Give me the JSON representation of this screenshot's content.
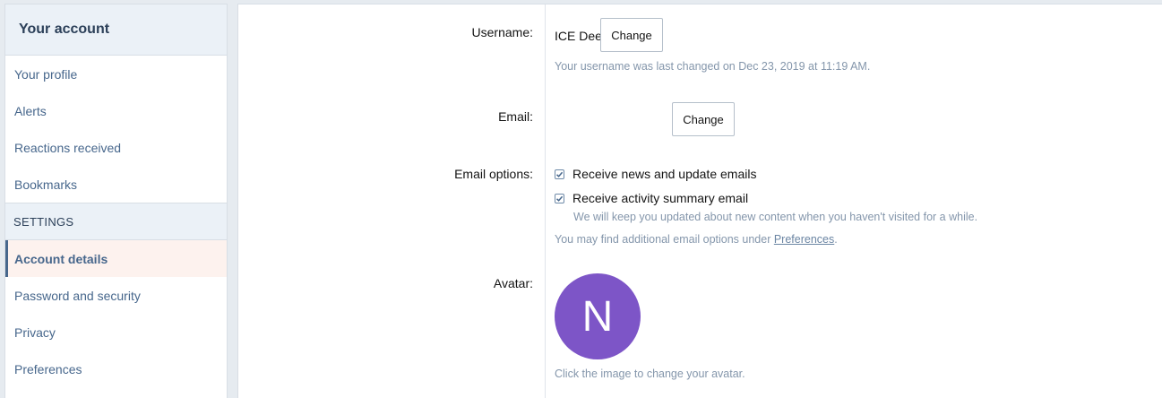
{
  "sidebar": {
    "title": "Your account",
    "items_top": [
      {
        "label": "Your profile"
      },
      {
        "label": "Alerts"
      },
      {
        "label": "Reactions received"
      },
      {
        "label": "Bookmarks"
      }
    ],
    "settings_header": "SETTINGS",
    "items_settings": [
      {
        "label": "Account details",
        "active": true
      },
      {
        "label": "Password and security"
      },
      {
        "label": "Privacy"
      },
      {
        "label": "Preferences"
      }
    ]
  },
  "form": {
    "username": {
      "label": "Username:",
      "value": "ICE Dee",
      "change_label": "Change",
      "hint": "Your username was last changed on Dec 23, 2019 at 11:19 AM."
    },
    "email": {
      "label": "Email:",
      "change_label": "Change"
    },
    "email_options": {
      "label": "Email options:",
      "option1": "Receive news and update emails",
      "option1_checked": true,
      "option2": "Receive activity summary email",
      "option2_checked": true,
      "option2_hint": "We will keep you updated about new content when you haven't visited for a while.",
      "more_prefix": "You may find additional email options under ",
      "more_link": "Preferences",
      "more_suffix": "."
    },
    "avatar": {
      "label": "Avatar:",
      "letter": "N",
      "color": "#7d55c7",
      "hint": "Click the image to change your avatar."
    }
  },
  "colors": {
    "accent": "#47678c",
    "active_bg": "#fdf2ee",
    "hint": "#8496ab"
  }
}
